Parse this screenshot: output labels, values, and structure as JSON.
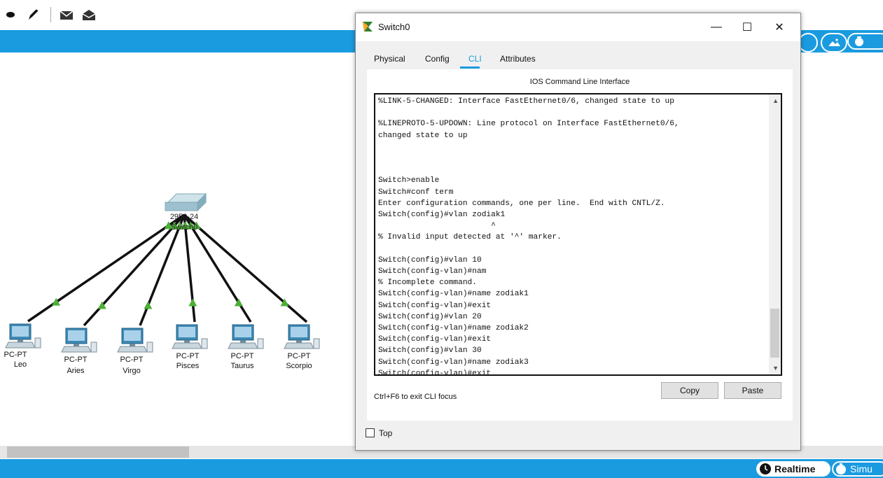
{
  "toolbar": {
    "icons": [
      "oval-shape-icon",
      "pen-icon",
      "mail-compose-icon",
      "open-mail-icon"
    ]
  },
  "network": {
    "switch": {
      "model": "2950-24",
      "name": "Switch0"
    },
    "pcs": [
      {
        "type": "PC-PT",
        "name": "Leo"
      },
      {
        "type": "PC-PT",
        "name": "Aries"
      },
      {
        "type": "PC-PT",
        "name": "Virgo"
      },
      {
        "type": "PC-PT",
        "name": "Pisces"
      },
      {
        "type": "PC-PT",
        "name": "Taurus"
      },
      {
        "type": "PC-PT",
        "name": "Scorpio"
      }
    ],
    "link_color": "#111111",
    "link_status_color": "#4caf36"
  },
  "dialog": {
    "title": "Switch0",
    "window_buttons": {
      "minimize": "—",
      "maximize": "☐",
      "close": "✕"
    },
    "tabs": [
      {
        "label": "Physical"
      },
      {
        "label": "Config"
      },
      {
        "label": "CLI"
      },
      {
        "label": "Attributes"
      }
    ],
    "active_tab": "CLI",
    "panel_title": "IOS Command Line Interface",
    "cli_output": "%LINK-5-CHANGED: Interface FastEthernet0/6, changed state to up\n\n%LINEPROTO-5-UPDOWN: Line protocol on Interface FastEthernet0/6,\nchanged state to up\n\n\n\nSwitch>enable\nSwitch#conf term\nEnter configuration commands, one per line.  End with CNTL/Z.\nSwitch(config)#vlan zodiak1\n                        ^\n% Invalid input detected at '^' marker.\n\nSwitch(config)#vlan 10\nSwitch(config-vlan)#nam\n% Incomplete command.\nSwitch(config-vlan)#name zodiak1\nSwitch(config-vlan)#exit\nSwitch(config)#vlan 20\nSwitch(config-vlan)#name zodiak2\nSwitch(config-vlan)#exit\nSwitch(config)#vlan 30\nSwitch(config-vlan)#name zodiak3\nSwitch(config-vlan)#exit\nSwitch(config)#",
    "hint": "Ctrl+F6 to exit CLI focus",
    "copy_label": "Copy",
    "paste_label": "Paste",
    "top_label": "Top",
    "top_checked": false
  },
  "statusbar": {
    "realtime_label": "Realtime",
    "simulation_label": "Simu"
  },
  "colors": {
    "accent": "#1a9be0"
  }
}
